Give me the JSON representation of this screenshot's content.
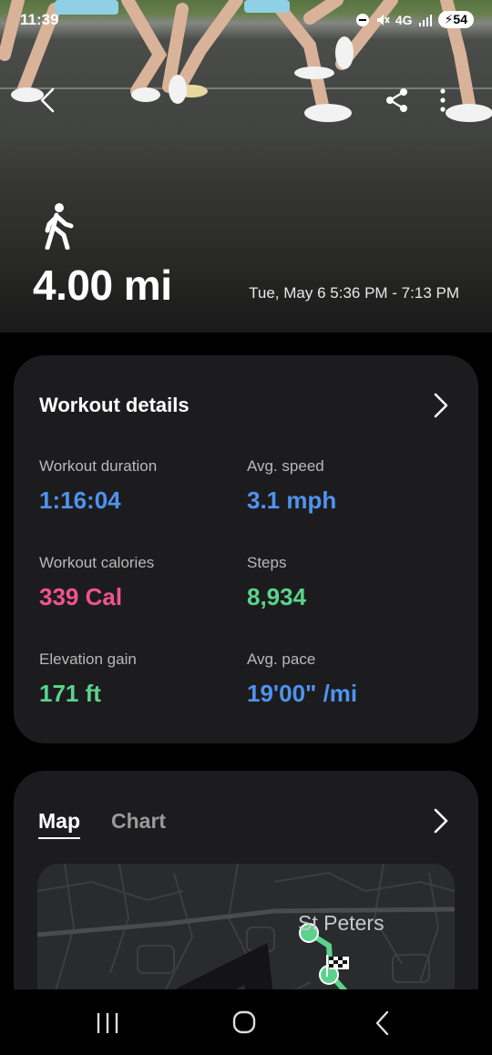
{
  "status_bar": {
    "time": "11:39",
    "network": "4G",
    "battery": "54"
  },
  "hero": {
    "distance": "4.00 mi",
    "date_range": "Tue, May 6 5:36 PM - 7:13 PM",
    "activity_icon": "walking-icon"
  },
  "details": {
    "title": "Workout details",
    "metrics": [
      {
        "label": "Workout duration",
        "value": "1:16:04",
        "color": "#4f93ee"
      },
      {
        "label": "Avg. speed",
        "value": "3.1 mph",
        "color": "#4f93ee"
      },
      {
        "label": "Workout calories",
        "value": "339 Cal",
        "color": "#f0558a"
      },
      {
        "label": "Steps",
        "value": "8,934",
        "color": "#5bd38c"
      },
      {
        "label": "Elevation gain",
        "value": "171 ft",
        "color": "#5bd38c"
      },
      {
        "label": "Avg. pace",
        "value": "19'00\" /mi",
        "color": "#4f93ee"
      }
    ]
  },
  "map_section": {
    "tabs": [
      {
        "label": "Map",
        "selected": true
      },
      {
        "label": "Chart",
        "selected": false
      }
    ],
    "place_label": "St Peters"
  },
  "colors": {
    "card_bg": "#1c1c1e",
    "accent_blue": "#4f93ee",
    "accent_pink": "#f0558a",
    "accent_green": "#5bd38c"
  }
}
